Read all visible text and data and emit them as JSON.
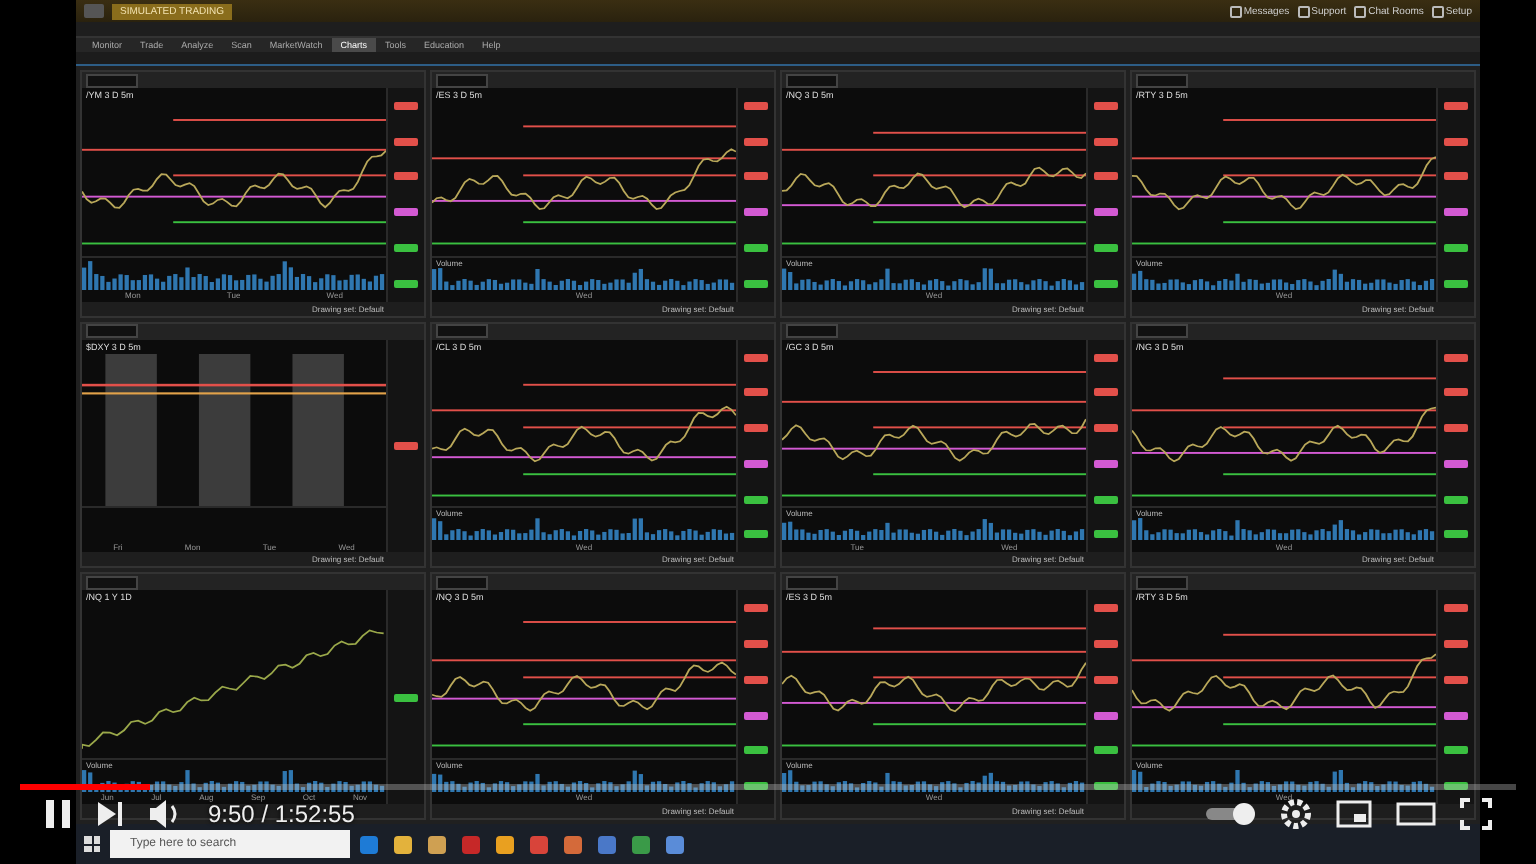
{
  "title_bar": {
    "badge": "SIMULATED TRADING",
    "links": [
      "Messages",
      "Support",
      "Chat Rooms",
      "Setup"
    ]
  },
  "menu": [
    {
      "label": "Monitor",
      "selected": false
    },
    {
      "label": "Trade",
      "selected": false
    },
    {
      "label": "Analyze",
      "selected": false
    },
    {
      "label": "Scan",
      "selected": false
    },
    {
      "label": "MarketWatch",
      "selected": false
    },
    {
      "label": "Charts",
      "selected": true
    },
    {
      "label": "Tools",
      "selected": false
    },
    {
      "label": "Education",
      "selected": false
    },
    {
      "label": "Help",
      "selected": false
    }
  ],
  "charts": [
    {
      "kind": "intraday",
      "title": "/YM 3 D 5m",
      "x_labels": [
        "Mon",
        "Tue",
        "Wed"
      ],
      "footer": "Drawing set: Default"
    },
    {
      "kind": "intraday",
      "title": "/ES 3 D 5m",
      "volume_label": "Volume",
      "x_labels": [
        "Wed"
      ],
      "footer": "Drawing set: Default"
    },
    {
      "kind": "intraday",
      "title": "/NQ 3 D 5m",
      "volume_label": "Volume",
      "x_labels": [
        "Wed"
      ],
      "footer": "Drawing set: Default"
    },
    {
      "kind": "intraday",
      "title": "/RTY 3 D 5m",
      "volume_label": "Volume",
      "x_labels": [
        "Wed"
      ],
      "footer": "Drawing set: Default"
    },
    {
      "kind": "sessions",
      "title": "$DXY 3 D 5m",
      "x_labels": [
        "Fri",
        "Mon",
        "Tue",
        "Wed"
      ],
      "footer": "Drawing set: Default"
    },
    {
      "kind": "intraday",
      "title": "/CL 3 D 5m",
      "volume_label": "Volume",
      "x_labels": [
        "Wed"
      ],
      "footer": "Drawing set: Default"
    },
    {
      "kind": "intraday",
      "title": "/GC 3 D 5m",
      "volume_label": "Volume",
      "x_labels": [
        "Tue",
        "Wed"
      ],
      "footer": "Drawing set: Default"
    },
    {
      "kind": "intraday",
      "title": "/NG 3 D 5m",
      "volume_label": "Volume",
      "x_labels": [
        "Wed"
      ],
      "footer": "Drawing set: Default"
    },
    {
      "kind": "trend",
      "title": "/NQ 1 Y 1D",
      "volume_label": "Volume",
      "x_labels": [
        "Jun",
        "Jul",
        "Aug",
        "Sep",
        "Oct",
        "Nov"
      ]
    },
    {
      "kind": "intraday",
      "title": "/NQ 3 D 5m",
      "volume_label": "Volume",
      "x_labels": [
        "Wed"
      ],
      "footer": "Drawing set: Default"
    },
    {
      "kind": "intraday",
      "title": "/ES 3 D 5m",
      "volume_label": "Volume",
      "x_labels": [
        "Wed"
      ],
      "footer": "Drawing set: Default"
    },
    {
      "kind": "intraday",
      "title": "/RTY 3 D 5m",
      "volume_label": "Volume",
      "x_labels": [
        "Wed"
      ]
    }
  ],
  "player": {
    "time": "9:50 / 1:52:55",
    "progress": {
      "level": 0.087
    }
  },
  "taskbar": {
    "search": {
      "placeholder": "Type here to search"
    }
  }
}
